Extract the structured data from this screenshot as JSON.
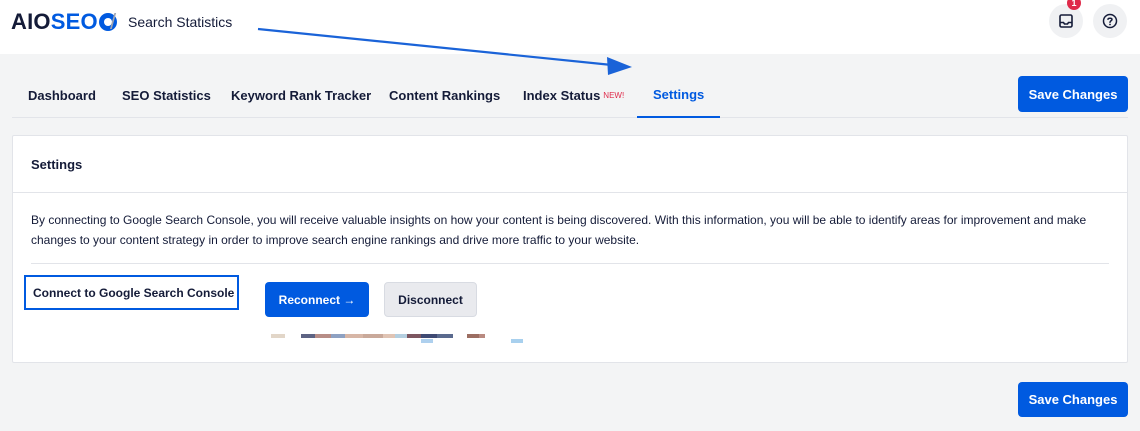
{
  "header": {
    "logo_left": "AIO",
    "logo_right": "SEO",
    "breadcrumb_separator": "/",
    "breadcrumb_title": "Search Statistics",
    "notification_count": "1",
    "inbox_icon": "inbox-icon",
    "help_icon": "help-icon"
  },
  "tabs": [
    {
      "label": "Dashboard",
      "active": false
    },
    {
      "label": "SEO Statistics",
      "active": false
    },
    {
      "label": "Keyword Rank Tracker",
      "active": false
    },
    {
      "label": "Content Rankings",
      "active": false
    },
    {
      "label": "Index Status",
      "badge": "NEW!",
      "active": false
    },
    {
      "label": "Settings",
      "active": true
    }
  ],
  "actions": {
    "save_label": "Save Changes"
  },
  "card": {
    "title": "Settings",
    "description": "By connecting to Google Search Console, you will receive valuable insights on how your content is being discovered. With this information, you will be able to identify areas for improvement and make changes to your content strategy in order to improve search engine rankings and drive more traffic to your website.",
    "connect_label": "Connect to Google Search Console",
    "reconnect_label": "Reconnect →",
    "disconnect_label": "Disconnect"
  },
  "colors": {
    "accent": "#005ae0",
    "badge": "#df2a4a",
    "text": "#141b38"
  }
}
